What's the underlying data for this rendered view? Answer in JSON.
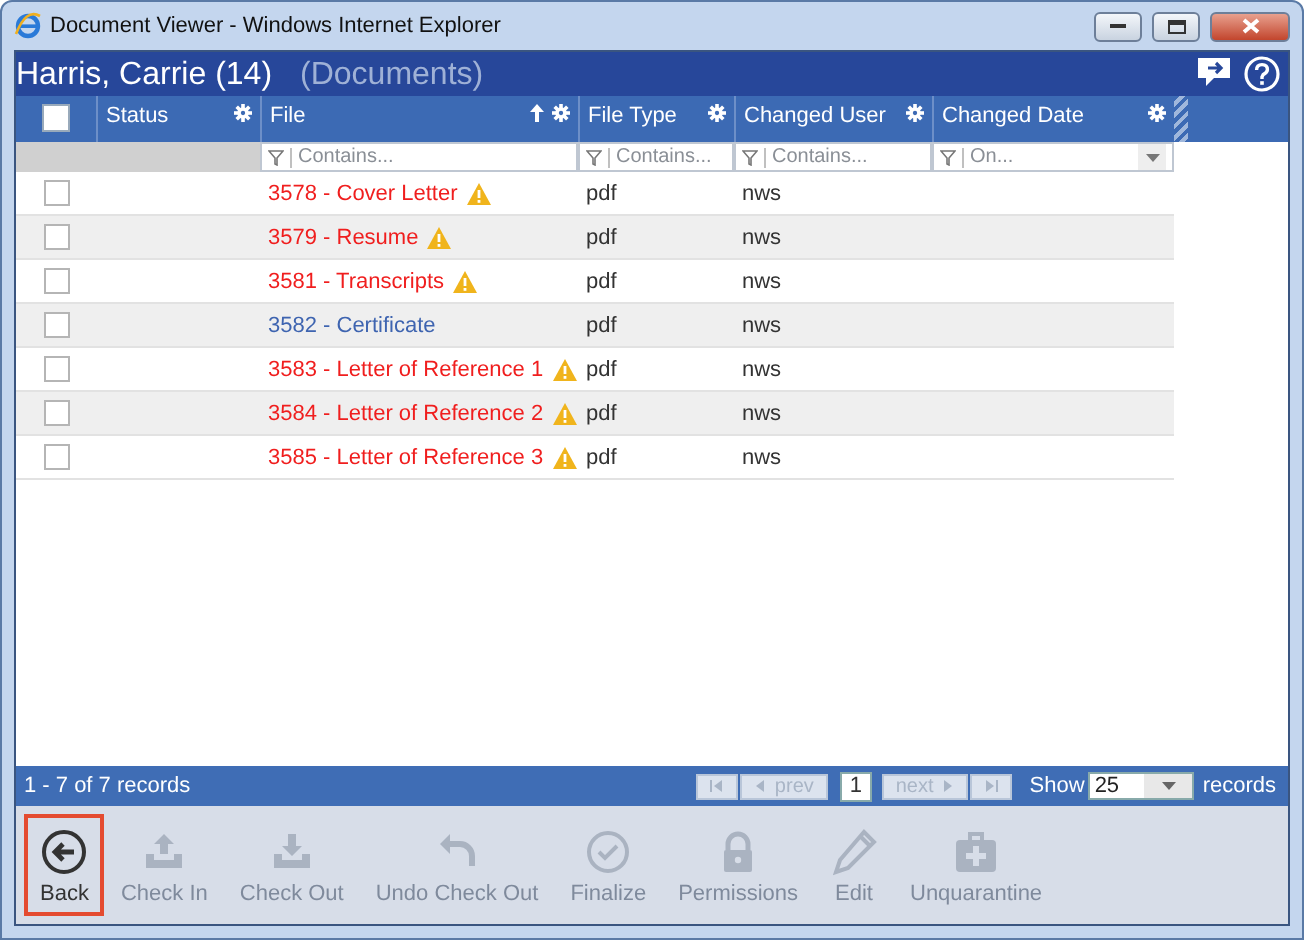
{
  "window": {
    "title": "Document Viewer - Windows Internet Explorer"
  },
  "header": {
    "title": "Harris, Carrie (14)",
    "subtitle": "(Documents)"
  },
  "grid": {
    "select_all": {
      "checked": false
    },
    "columns": [
      {
        "label": "Status",
        "sorted": false
      },
      {
        "label": "File",
        "sorted": true,
        "filter": "Contains..."
      },
      {
        "label": "File Type",
        "sorted": false,
        "filter": "Contains..."
      },
      {
        "label": "Changed User",
        "sorted": false,
        "filter": "Contains..."
      },
      {
        "label": "Changed Date",
        "sorted": false,
        "filter": "On..."
      }
    ],
    "rows": [
      {
        "checked": false,
        "file": "3578 - Cover Letter",
        "warning": true,
        "file_type": "pdf",
        "changed_user": "nws"
      },
      {
        "checked": false,
        "file": "3579 - Resume",
        "warning": true,
        "file_type": "pdf",
        "changed_user": "nws"
      },
      {
        "checked": false,
        "file": "3581 - Transcripts",
        "warning": true,
        "file_type": "pdf",
        "changed_user": "nws"
      },
      {
        "checked": false,
        "file": "3582 - Certificate",
        "warning": false,
        "file_type": "pdf",
        "changed_user": "nws"
      },
      {
        "checked": false,
        "file": "3583 - Letter of Reference 1",
        "warning": true,
        "file_type": "pdf",
        "changed_user": "nws"
      },
      {
        "checked": false,
        "file": "3584 - Letter of Reference 2",
        "warning": true,
        "file_type": "pdf",
        "changed_user": "nws"
      },
      {
        "checked": false,
        "file": "3585 - Letter of Reference 3",
        "warning": true,
        "file_type": "pdf",
        "changed_user": "nws"
      }
    ]
  },
  "pager": {
    "summary": "1 - 7 of 7 records",
    "prev": "prev",
    "page": "1",
    "next": "next",
    "show_label": "Show",
    "page_size": "25",
    "records_label": "records"
  },
  "toolbar": [
    {
      "kind": "back",
      "label": "Back",
      "disabled": false,
      "selected": true
    },
    {
      "kind": "checkin",
      "label": "Check In",
      "disabled": true,
      "selected": false
    },
    {
      "kind": "checkout",
      "label": "Check Out",
      "disabled": true,
      "selected": false
    },
    {
      "kind": "undo",
      "label": "Undo Check Out",
      "disabled": true,
      "selected": false
    },
    {
      "kind": "finalize",
      "label": "Finalize",
      "disabled": true,
      "selected": false
    },
    {
      "kind": "permissions",
      "label": "Permissions",
      "disabled": true,
      "selected": false
    },
    {
      "kind": "edit",
      "label": "Edit",
      "disabled": true,
      "selected": false
    },
    {
      "kind": "unquarantine",
      "label": "Unquarantine",
      "disabled": true,
      "selected": false
    }
  ]
}
